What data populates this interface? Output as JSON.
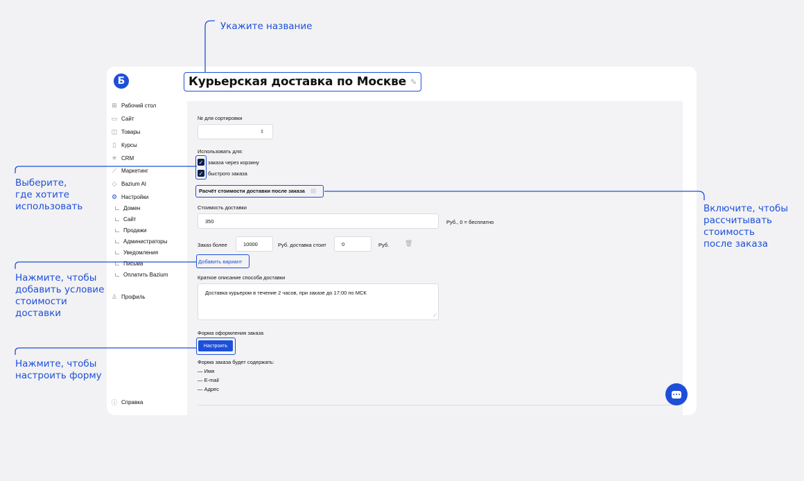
{
  "annotations": {
    "name": "Укажите название",
    "use_for": [
      "Выберите,",
      "где хотите",
      "использовать"
    ],
    "calc": [
      "Включите, чтобы",
      "рассчитывать",
      "стоимость",
      "после заказа"
    ],
    "add_condition": [
      "Нажмите, чтобы",
      "добавить условие",
      "стоимости",
      "доставки"
    ],
    "configure": [
      "Нажмите, чтобы",
      "настроить форму"
    ]
  },
  "app": {
    "logo": "Б",
    "title": "Курьерская доставка по Москве"
  },
  "sidebar": {
    "items": [
      {
        "label": "Рабочий стол",
        "icon": "dashboard-icon"
      },
      {
        "label": "Сайт",
        "icon": "site-icon"
      },
      {
        "label": "Товары",
        "icon": "bag-icon"
      },
      {
        "label": "Курсы",
        "icon": "book-icon"
      },
      {
        "label": "CRM",
        "icon": "crm-icon"
      },
      {
        "label": "Маркетинг",
        "icon": "chart-icon"
      },
      {
        "label": "Bazium AI",
        "icon": "ai-icon"
      },
      {
        "label": "Настройки",
        "icon": "gear-icon"
      }
    ],
    "sub_items": [
      "Домен",
      "Сайт",
      "Продажи",
      "Администраторы",
      "Уведомления",
      "Письма",
      "Оплатить Bazium"
    ],
    "profile": "Профиль",
    "help": "Справка"
  },
  "form": {
    "sort_label": "№ для сортировки",
    "sort_value": "",
    "use_label": "Использовать для:",
    "use_options": [
      {
        "label": "заказа через корзину",
        "checked": true
      },
      {
        "label": "быстрого заказа",
        "checked": true
      }
    ],
    "calc_after_label": "Расчёт стоимости доставки после заказа",
    "calc_after_enabled": false,
    "cost_label": "Стоимость доставки",
    "cost_value": "350",
    "cost_suffix": "Руб., 0 = бесплатно",
    "condition": {
      "order_more_label": "Заказ более",
      "order_more_value": "10000",
      "cost_label": "Руб. доставка стоит",
      "cost_value": "0",
      "suffix": "Руб."
    },
    "add_variant": "Добавить вариант",
    "desc_label": "Краткое описание способа доставки",
    "desc_value": "Доставка курьером в течение 2 часов, при заказе до 17:00 по МСК",
    "order_form_label": "Форма оформления заказа",
    "configure_button": "Настроить",
    "will_contain": "Форма заказа будет содержать:",
    "fields": [
      "— Имя",
      "— E-mail",
      "— Адрес"
    ]
  },
  "colors": {
    "accent": "#1d4fd8",
    "checkbox": "#0d1f4a"
  }
}
